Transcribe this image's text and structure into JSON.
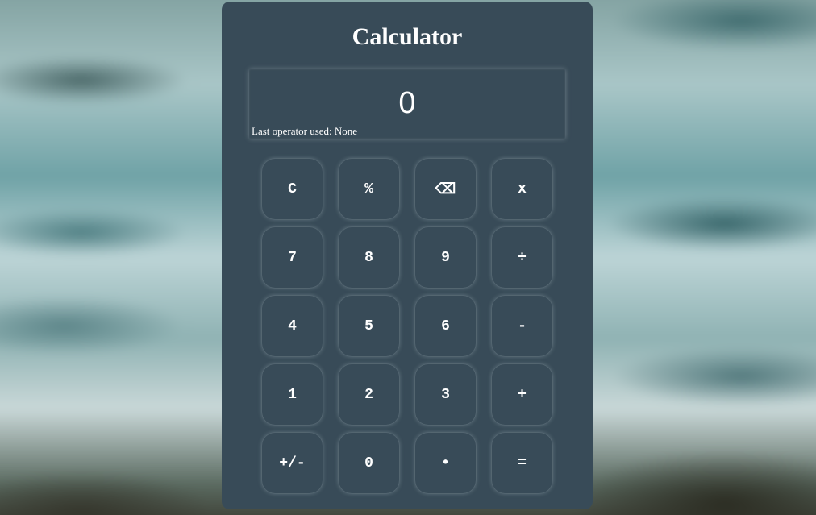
{
  "app": {
    "title": "Calculator"
  },
  "display": {
    "value": "0",
    "status": "Last operator used: None"
  },
  "keys": {
    "clear": "C",
    "percent": "%",
    "backspace": "⌫",
    "multiply": "x",
    "seven": "7",
    "eight": "8",
    "nine": "9",
    "divide": "÷",
    "four": "4",
    "five": "5",
    "six": "6",
    "subtract": "-",
    "one": "1",
    "two": "2",
    "three": "3",
    "add": "+",
    "negate": "+/-",
    "zero": "0",
    "decimal": "•",
    "equals": "="
  },
  "colors": {
    "panel": "#384b58",
    "text": "#ffffff"
  }
}
